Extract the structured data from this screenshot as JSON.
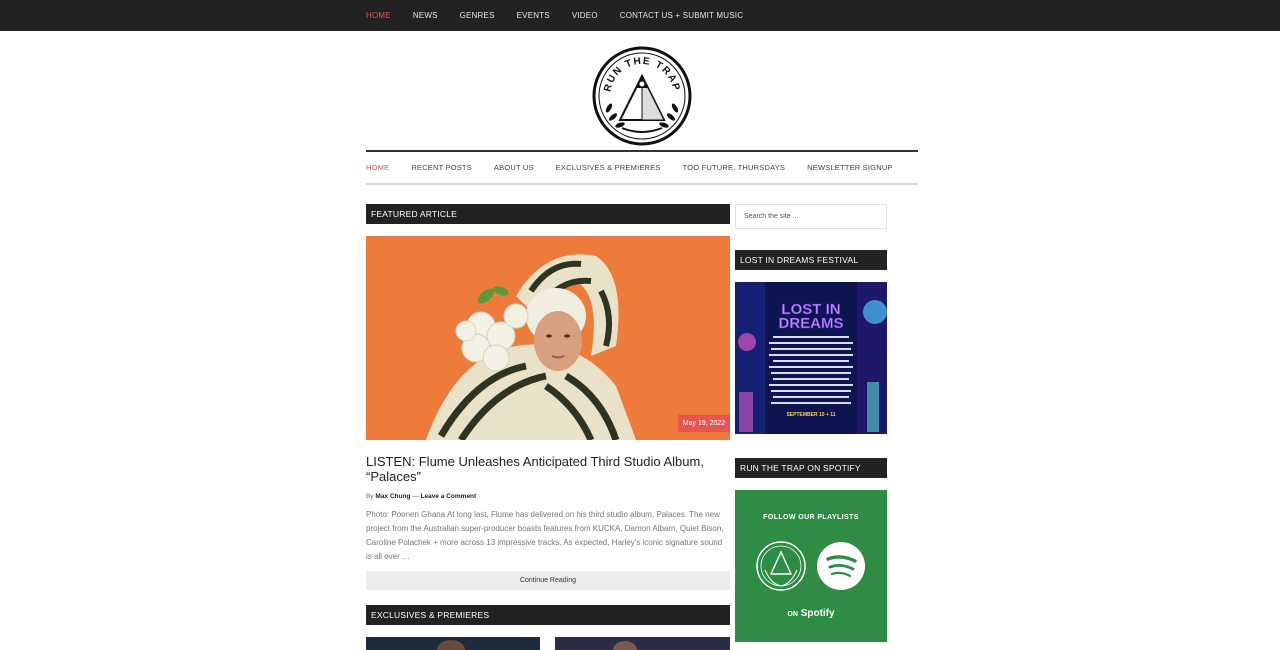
{
  "topnav": [
    {
      "label": "HOME",
      "active": true
    },
    {
      "label": "NEWS"
    },
    {
      "label": "GENRES"
    },
    {
      "label": "EVENTS"
    },
    {
      "label": "VIDEO"
    },
    {
      "label": "CONTACT US + SUBMIT MUSIC"
    }
  ],
  "logo": {
    "text": "RUN THE TRAP"
  },
  "subnav": [
    {
      "label": "HOME",
      "active": true
    },
    {
      "label": "RECENT POSTS"
    },
    {
      "label": "ABOUT US"
    },
    {
      "label": "EXCLUSIVES & PREMIERES"
    },
    {
      "label": "TOO FUTURE. THURSDAYS"
    },
    {
      "label": "NEWSLETTER SIGNUP"
    }
  ],
  "featured": {
    "header": "FEATURED ARTICLE",
    "date": "May 19, 2022",
    "title": "LISTEN: Flume Unleashes Anticipated Third Studio Album, “Palaces”",
    "by_prefix": "By",
    "author": "Max Chung",
    "separator": "—",
    "comment_link": "Leave a Comment",
    "excerpt": "Photo: Poonen Ghana At long last, Flume has delivered on his third studio album, Palaces. The new project from the Australian super-producer boasts features from KUCKA, Damon Albarn, Quiet Bison, Caroline Polachek + more across 13 impressive tracks. As expected, Harley's iconic signature sound is all over …",
    "continue_label": "Continue Reading"
  },
  "exclusives": {
    "header": "EXCLUSIVES & PREMIERES"
  },
  "sidebar": {
    "search_placeholder": "Search the site ...",
    "festival_header": "LOST IN DREAMS FESTIVAL",
    "festival_poster_title_1": "LOST IN",
    "festival_poster_title_2": "DREAMS",
    "festival_poster_date": "SEPTEMBER 10 + 11",
    "spotify_header": "RUN THE TRAP ON SPOTIFY",
    "spotify_follow": "FOLLOW OUR PLAYLISTS",
    "spotify_on": "ON",
    "spotify_brand": "Spotify"
  },
  "colors": {
    "accent": "#e8554e",
    "dark": "#222222",
    "featured_bg": "#ec7a3a",
    "spotify_green": "#2e8c45"
  }
}
